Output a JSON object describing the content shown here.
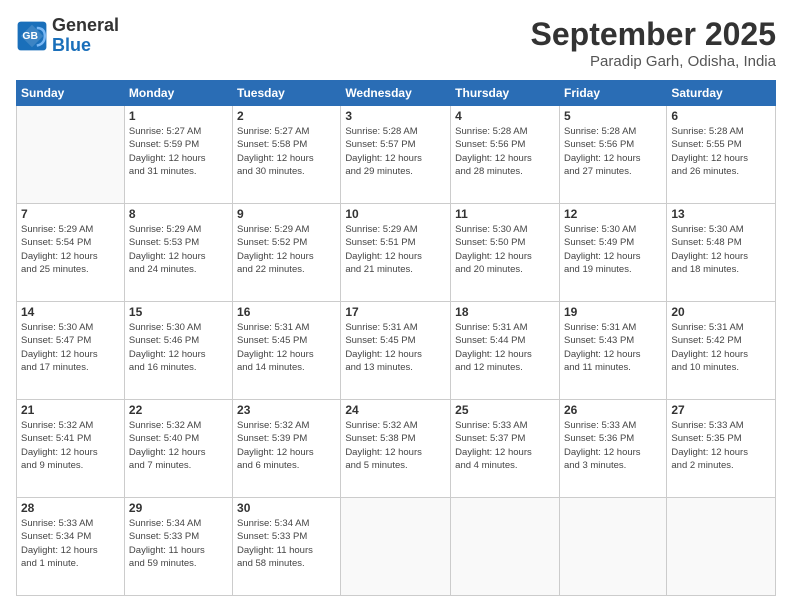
{
  "header": {
    "logo_line1": "General",
    "logo_line2": "Blue",
    "month": "September 2025",
    "location": "Paradip Garh, Odisha, India"
  },
  "weekdays": [
    "Sunday",
    "Monday",
    "Tuesday",
    "Wednesday",
    "Thursday",
    "Friday",
    "Saturday"
  ],
  "weeks": [
    [
      {
        "day": "",
        "info": ""
      },
      {
        "day": "1",
        "info": "Sunrise: 5:27 AM\nSunset: 5:59 PM\nDaylight: 12 hours\nand 31 minutes."
      },
      {
        "day": "2",
        "info": "Sunrise: 5:27 AM\nSunset: 5:58 PM\nDaylight: 12 hours\nand 30 minutes."
      },
      {
        "day": "3",
        "info": "Sunrise: 5:28 AM\nSunset: 5:57 PM\nDaylight: 12 hours\nand 29 minutes."
      },
      {
        "day": "4",
        "info": "Sunrise: 5:28 AM\nSunset: 5:56 PM\nDaylight: 12 hours\nand 28 minutes."
      },
      {
        "day": "5",
        "info": "Sunrise: 5:28 AM\nSunset: 5:56 PM\nDaylight: 12 hours\nand 27 minutes."
      },
      {
        "day": "6",
        "info": "Sunrise: 5:28 AM\nSunset: 5:55 PM\nDaylight: 12 hours\nand 26 minutes."
      }
    ],
    [
      {
        "day": "7",
        "info": "Sunrise: 5:29 AM\nSunset: 5:54 PM\nDaylight: 12 hours\nand 25 minutes."
      },
      {
        "day": "8",
        "info": "Sunrise: 5:29 AM\nSunset: 5:53 PM\nDaylight: 12 hours\nand 24 minutes."
      },
      {
        "day": "9",
        "info": "Sunrise: 5:29 AM\nSunset: 5:52 PM\nDaylight: 12 hours\nand 22 minutes."
      },
      {
        "day": "10",
        "info": "Sunrise: 5:29 AM\nSunset: 5:51 PM\nDaylight: 12 hours\nand 21 minutes."
      },
      {
        "day": "11",
        "info": "Sunrise: 5:30 AM\nSunset: 5:50 PM\nDaylight: 12 hours\nand 20 minutes."
      },
      {
        "day": "12",
        "info": "Sunrise: 5:30 AM\nSunset: 5:49 PM\nDaylight: 12 hours\nand 19 minutes."
      },
      {
        "day": "13",
        "info": "Sunrise: 5:30 AM\nSunset: 5:48 PM\nDaylight: 12 hours\nand 18 minutes."
      }
    ],
    [
      {
        "day": "14",
        "info": "Sunrise: 5:30 AM\nSunset: 5:47 PM\nDaylight: 12 hours\nand 17 minutes."
      },
      {
        "day": "15",
        "info": "Sunrise: 5:30 AM\nSunset: 5:46 PM\nDaylight: 12 hours\nand 16 minutes."
      },
      {
        "day": "16",
        "info": "Sunrise: 5:31 AM\nSunset: 5:45 PM\nDaylight: 12 hours\nand 14 minutes."
      },
      {
        "day": "17",
        "info": "Sunrise: 5:31 AM\nSunset: 5:45 PM\nDaylight: 12 hours\nand 13 minutes."
      },
      {
        "day": "18",
        "info": "Sunrise: 5:31 AM\nSunset: 5:44 PM\nDaylight: 12 hours\nand 12 minutes."
      },
      {
        "day": "19",
        "info": "Sunrise: 5:31 AM\nSunset: 5:43 PM\nDaylight: 12 hours\nand 11 minutes."
      },
      {
        "day": "20",
        "info": "Sunrise: 5:31 AM\nSunset: 5:42 PM\nDaylight: 12 hours\nand 10 minutes."
      }
    ],
    [
      {
        "day": "21",
        "info": "Sunrise: 5:32 AM\nSunset: 5:41 PM\nDaylight: 12 hours\nand 9 minutes."
      },
      {
        "day": "22",
        "info": "Sunrise: 5:32 AM\nSunset: 5:40 PM\nDaylight: 12 hours\nand 7 minutes."
      },
      {
        "day": "23",
        "info": "Sunrise: 5:32 AM\nSunset: 5:39 PM\nDaylight: 12 hours\nand 6 minutes."
      },
      {
        "day": "24",
        "info": "Sunrise: 5:32 AM\nSunset: 5:38 PM\nDaylight: 12 hours\nand 5 minutes."
      },
      {
        "day": "25",
        "info": "Sunrise: 5:33 AM\nSunset: 5:37 PM\nDaylight: 12 hours\nand 4 minutes."
      },
      {
        "day": "26",
        "info": "Sunrise: 5:33 AM\nSunset: 5:36 PM\nDaylight: 12 hours\nand 3 minutes."
      },
      {
        "day": "27",
        "info": "Sunrise: 5:33 AM\nSunset: 5:35 PM\nDaylight: 12 hours\nand 2 minutes."
      }
    ],
    [
      {
        "day": "28",
        "info": "Sunrise: 5:33 AM\nSunset: 5:34 PM\nDaylight: 12 hours\nand 1 minute."
      },
      {
        "day": "29",
        "info": "Sunrise: 5:34 AM\nSunset: 5:33 PM\nDaylight: 11 hours\nand 59 minutes."
      },
      {
        "day": "30",
        "info": "Sunrise: 5:34 AM\nSunset: 5:33 PM\nDaylight: 11 hours\nand 58 minutes."
      },
      {
        "day": "",
        "info": ""
      },
      {
        "day": "",
        "info": ""
      },
      {
        "day": "",
        "info": ""
      },
      {
        "day": "",
        "info": ""
      }
    ]
  ]
}
